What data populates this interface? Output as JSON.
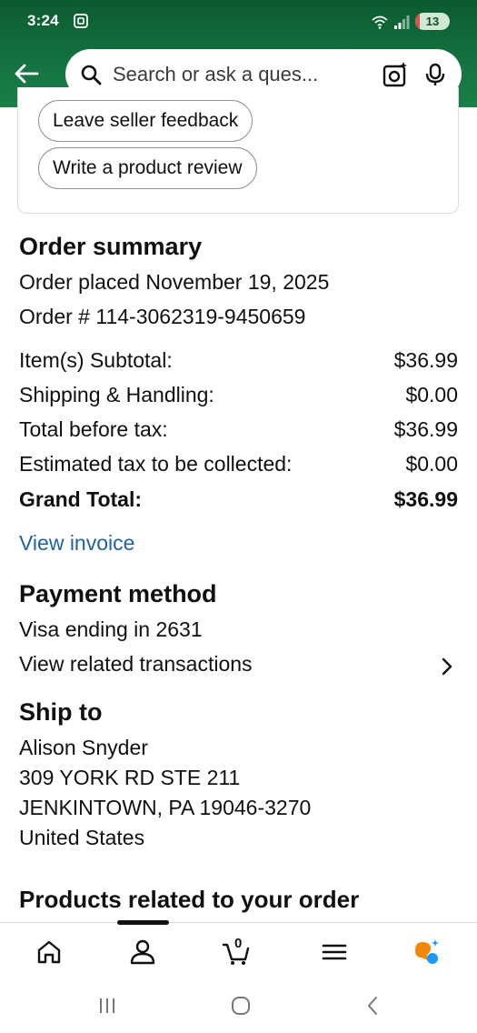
{
  "status_bar": {
    "time": "3:24",
    "battery": "13",
    "battery_level": 0.13
  },
  "search": {
    "placeholder": "Search or ask a ques..."
  },
  "actions": {
    "leave_feedback": "Leave seller feedback",
    "write_review": "Write a product review"
  },
  "order_summary": {
    "title": "Order summary",
    "placed_label": "Order placed",
    "placed_date": "November 19, 2025",
    "number_label": "Order #",
    "number": "114-3062319-9450659",
    "lines": [
      {
        "label": "Item(s) Subtotal:",
        "value": "$36.99"
      },
      {
        "label": "Shipping & Handling:",
        "value": "$0.00"
      },
      {
        "label": "Total before tax:",
        "value": "$36.99"
      },
      {
        "label": "Estimated tax to be collected:",
        "value": "$0.00"
      }
    ],
    "grand_total": {
      "label": "Grand Total:",
      "value": "$36.99"
    },
    "view_invoice": "View invoice"
  },
  "payment": {
    "title": "Payment method",
    "card": "Visa ending in 2631",
    "related": "View related transactions"
  },
  "ship_to": {
    "title": "Ship to",
    "name": "Alison Snyder",
    "street": "309 YORK RD STE 211",
    "city": "JENKINTOWN, PA 19046-3270",
    "country": "United States"
  },
  "related": {
    "title": "Products related to your order"
  },
  "bottom_nav": {
    "cart_count": "0"
  },
  "colors": {
    "header": "#13713f",
    "link": "#2162a1",
    "text": "#0f1111",
    "assistant_orange": "#f08804",
    "assistant_blue": "#1a98ff"
  }
}
